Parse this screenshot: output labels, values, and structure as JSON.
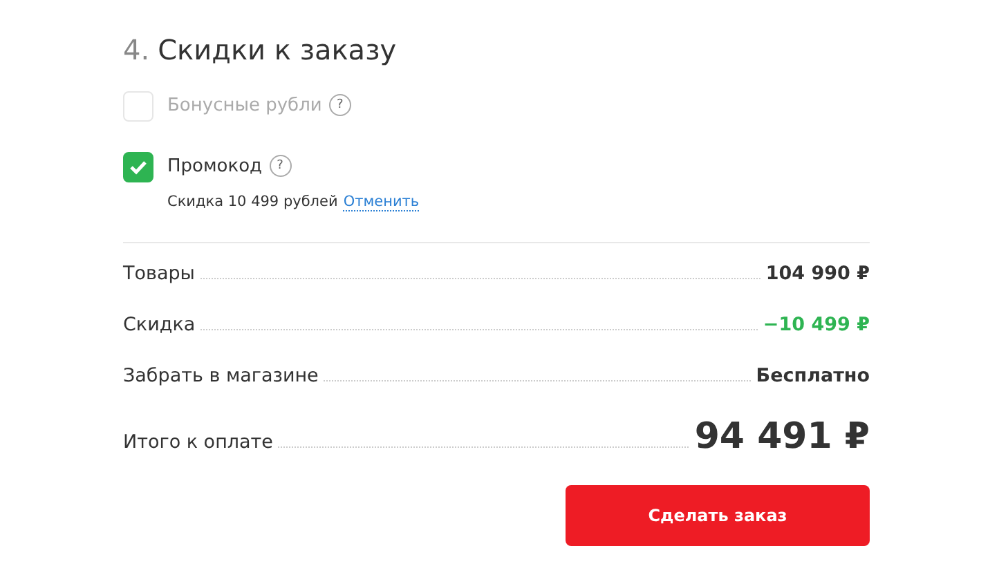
{
  "section": {
    "number": "4.",
    "title": "Скидки к заказу"
  },
  "options": [
    {
      "label": "Бонусные рубли",
      "help": "?",
      "checked": false,
      "disabled": true
    },
    {
      "label": "Промокод",
      "help": "?",
      "checked": true,
      "disabled": false,
      "detail": "Скидка 10 499 рублей",
      "action": "Отменить"
    }
  ],
  "summary": [
    {
      "kind": "normal",
      "label": "Товары",
      "value": "104 990 ₽"
    },
    {
      "kind": "discount",
      "label": "Скидка",
      "value": "−10 499 ₽"
    },
    {
      "kind": "normal",
      "label": "Забрать в магазине",
      "value": "Бесплатно"
    },
    {
      "kind": "total",
      "label": "Итого к оплате",
      "value": "94 491 ₽"
    }
  ],
  "submit": "Сделать заказ"
}
